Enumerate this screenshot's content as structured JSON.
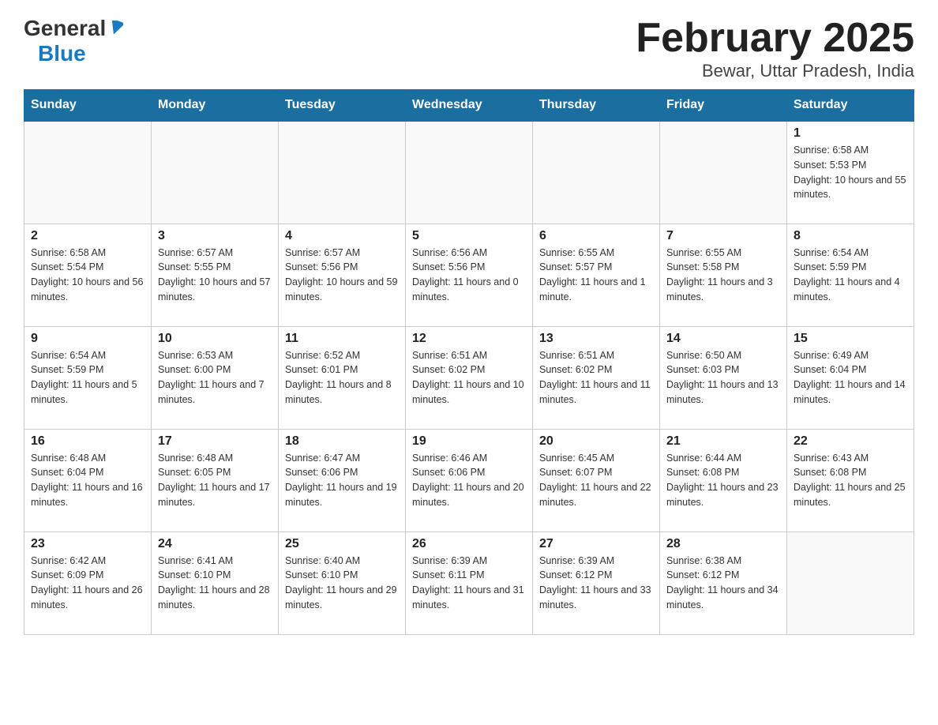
{
  "header": {
    "logo": {
      "general": "General",
      "blue": "Blue",
      "tagline": ""
    },
    "title": "February 2025",
    "subtitle": "Bewar, Uttar Pradesh, India"
  },
  "days_of_week": [
    "Sunday",
    "Monday",
    "Tuesday",
    "Wednesday",
    "Thursday",
    "Friday",
    "Saturday"
  ],
  "weeks": [
    [
      {
        "day": "",
        "info": ""
      },
      {
        "day": "",
        "info": ""
      },
      {
        "day": "",
        "info": ""
      },
      {
        "day": "",
        "info": ""
      },
      {
        "day": "",
        "info": ""
      },
      {
        "day": "",
        "info": ""
      },
      {
        "day": "1",
        "info": "Sunrise: 6:58 AM\nSunset: 5:53 PM\nDaylight: 10 hours and 55 minutes."
      }
    ],
    [
      {
        "day": "2",
        "info": "Sunrise: 6:58 AM\nSunset: 5:54 PM\nDaylight: 10 hours and 56 minutes."
      },
      {
        "day": "3",
        "info": "Sunrise: 6:57 AM\nSunset: 5:55 PM\nDaylight: 10 hours and 57 minutes."
      },
      {
        "day": "4",
        "info": "Sunrise: 6:57 AM\nSunset: 5:56 PM\nDaylight: 10 hours and 59 minutes."
      },
      {
        "day": "5",
        "info": "Sunrise: 6:56 AM\nSunset: 5:56 PM\nDaylight: 11 hours and 0 minutes."
      },
      {
        "day": "6",
        "info": "Sunrise: 6:55 AM\nSunset: 5:57 PM\nDaylight: 11 hours and 1 minute."
      },
      {
        "day": "7",
        "info": "Sunrise: 6:55 AM\nSunset: 5:58 PM\nDaylight: 11 hours and 3 minutes."
      },
      {
        "day": "8",
        "info": "Sunrise: 6:54 AM\nSunset: 5:59 PM\nDaylight: 11 hours and 4 minutes."
      }
    ],
    [
      {
        "day": "9",
        "info": "Sunrise: 6:54 AM\nSunset: 5:59 PM\nDaylight: 11 hours and 5 minutes."
      },
      {
        "day": "10",
        "info": "Sunrise: 6:53 AM\nSunset: 6:00 PM\nDaylight: 11 hours and 7 minutes."
      },
      {
        "day": "11",
        "info": "Sunrise: 6:52 AM\nSunset: 6:01 PM\nDaylight: 11 hours and 8 minutes."
      },
      {
        "day": "12",
        "info": "Sunrise: 6:51 AM\nSunset: 6:02 PM\nDaylight: 11 hours and 10 minutes."
      },
      {
        "day": "13",
        "info": "Sunrise: 6:51 AM\nSunset: 6:02 PM\nDaylight: 11 hours and 11 minutes."
      },
      {
        "day": "14",
        "info": "Sunrise: 6:50 AM\nSunset: 6:03 PM\nDaylight: 11 hours and 13 minutes."
      },
      {
        "day": "15",
        "info": "Sunrise: 6:49 AM\nSunset: 6:04 PM\nDaylight: 11 hours and 14 minutes."
      }
    ],
    [
      {
        "day": "16",
        "info": "Sunrise: 6:48 AM\nSunset: 6:04 PM\nDaylight: 11 hours and 16 minutes."
      },
      {
        "day": "17",
        "info": "Sunrise: 6:48 AM\nSunset: 6:05 PM\nDaylight: 11 hours and 17 minutes."
      },
      {
        "day": "18",
        "info": "Sunrise: 6:47 AM\nSunset: 6:06 PM\nDaylight: 11 hours and 19 minutes."
      },
      {
        "day": "19",
        "info": "Sunrise: 6:46 AM\nSunset: 6:06 PM\nDaylight: 11 hours and 20 minutes."
      },
      {
        "day": "20",
        "info": "Sunrise: 6:45 AM\nSunset: 6:07 PM\nDaylight: 11 hours and 22 minutes."
      },
      {
        "day": "21",
        "info": "Sunrise: 6:44 AM\nSunset: 6:08 PM\nDaylight: 11 hours and 23 minutes."
      },
      {
        "day": "22",
        "info": "Sunrise: 6:43 AM\nSunset: 6:08 PM\nDaylight: 11 hours and 25 minutes."
      }
    ],
    [
      {
        "day": "23",
        "info": "Sunrise: 6:42 AM\nSunset: 6:09 PM\nDaylight: 11 hours and 26 minutes."
      },
      {
        "day": "24",
        "info": "Sunrise: 6:41 AM\nSunset: 6:10 PM\nDaylight: 11 hours and 28 minutes."
      },
      {
        "day": "25",
        "info": "Sunrise: 6:40 AM\nSunset: 6:10 PM\nDaylight: 11 hours and 29 minutes."
      },
      {
        "day": "26",
        "info": "Sunrise: 6:39 AM\nSunset: 6:11 PM\nDaylight: 11 hours and 31 minutes."
      },
      {
        "day": "27",
        "info": "Sunrise: 6:39 AM\nSunset: 6:12 PM\nDaylight: 11 hours and 33 minutes."
      },
      {
        "day": "28",
        "info": "Sunrise: 6:38 AM\nSunset: 6:12 PM\nDaylight: 11 hours and 34 minutes."
      },
      {
        "day": "",
        "info": ""
      }
    ]
  ]
}
